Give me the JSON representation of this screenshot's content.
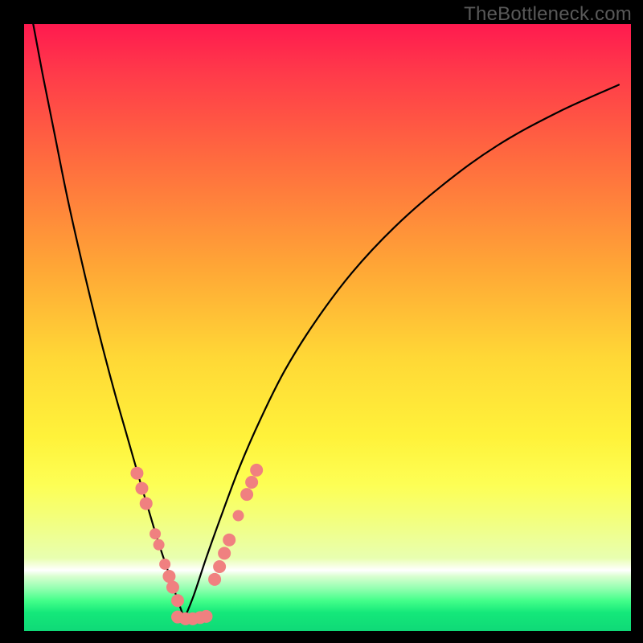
{
  "watermark": {
    "text": "TheBottleneck.com"
  },
  "colors": {
    "frame": "#000000",
    "curve": "#000000",
    "marker_fill": "#f08080",
    "marker_stroke": "#c06060"
  },
  "chart_data": {
    "type": "line",
    "title": "",
    "xlabel": "",
    "ylabel": "",
    "xlim": [
      0,
      100
    ],
    "ylim": [
      0,
      100
    ],
    "grid": false,
    "legend": false,
    "note": "Axes carry no tick labels; values are read as percent of plot width/height. y=0 is bottom (green), y=100 is top (red).",
    "series": [
      {
        "name": "left-branch",
        "x": [
          1.5,
          3,
          5,
          7,
          9,
          11,
          13,
          15,
          17,
          19,
          20.5,
          22,
          23.5,
          25,
          26.4
        ],
        "y": [
          100,
          92,
          82,
          72,
          63,
          54.5,
          46.5,
          39,
          32,
          25,
          20,
          15,
          10.5,
          6,
          2
        ]
      },
      {
        "name": "right-branch",
        "x": [
          26.4,
          28,
          30,
          32.5,
          35.5,
          39,
          43,
          48,
          54,
          61,
          69,
          78,
          88,
          98
        ],
        "y": [
          2,
          6,
          12,
          19,
          27,
          35,
          43,
          51,
          59,
          66.5,
          73.5,
          80,
          85.5,
          90
        ]
      }
    ],
    "markers_left": [
      {
        "x": 18.6,
        "y": 26.0,
        "r": 8
      },
      {
        "x": 19.4,
        "y": 23.5,
        "r": 8
      },
      {
        "x": 20.1,
        "y": 21.0,
        "r": 8
      },
      {
        "x": 21.6,
        "y": 16.0,
        "r": 7
      },
      {
        "x": 22.2,
        "y": 14.2,
        "r": 7
      },
      {
        "x": 23.2,
        "y": 11.0,
        "r": 7
      },
      {
        "x": 23.9,
        "y": 9.0,
        "r": 8
      },
      {
        "x": 24.5,
        "y": 7.2,
        "r": 8
      },
      {
        "x": 25.3,
        "y": 5.0,
        "r": 8
      }
    ],
    "markers_bottom": [
      {
        "x": 25.3,
        "y": 2.3,
        "r": 8
      },
      {
        "x": 26.6,
        "y": 2.0,
        "r": 8
      },
      {
        "x": 27.8,
        "y": 2.0,
        "r": 8
      },
      {
        "x": 29.0,
        "y": 2.2,
        "r": 8
      },
      {
        "x": 30.0,
        "y": 2.4,
        "r": 8
      }
    ],
    "markers_right": [
      {
        "x": 31.4,
        "y": 8.5,
        "r": 8
      },
      {
        "x": 32.2,
        "y": 10.6,
        "r": 8
      },
      {
        "x": 33.0,
        "y": 12.8,
        "r": 8
      },
      {
        "x": 33.8,
        "y": 15.0,
        "r": 8
      },
      {
        "x": 35.3,
        "y": 19.0,
        "r": 7
      },
      {
        "x": 36.7,
        "y": 22.5,
        "r": 8
      },
      {
        "x": 37.5,
        "y": 24.5,
        "r": 8
      },
      {
        "x": 38.3,
        "y": 26.5,
        "r": 8
      }
    ]
  }
}
